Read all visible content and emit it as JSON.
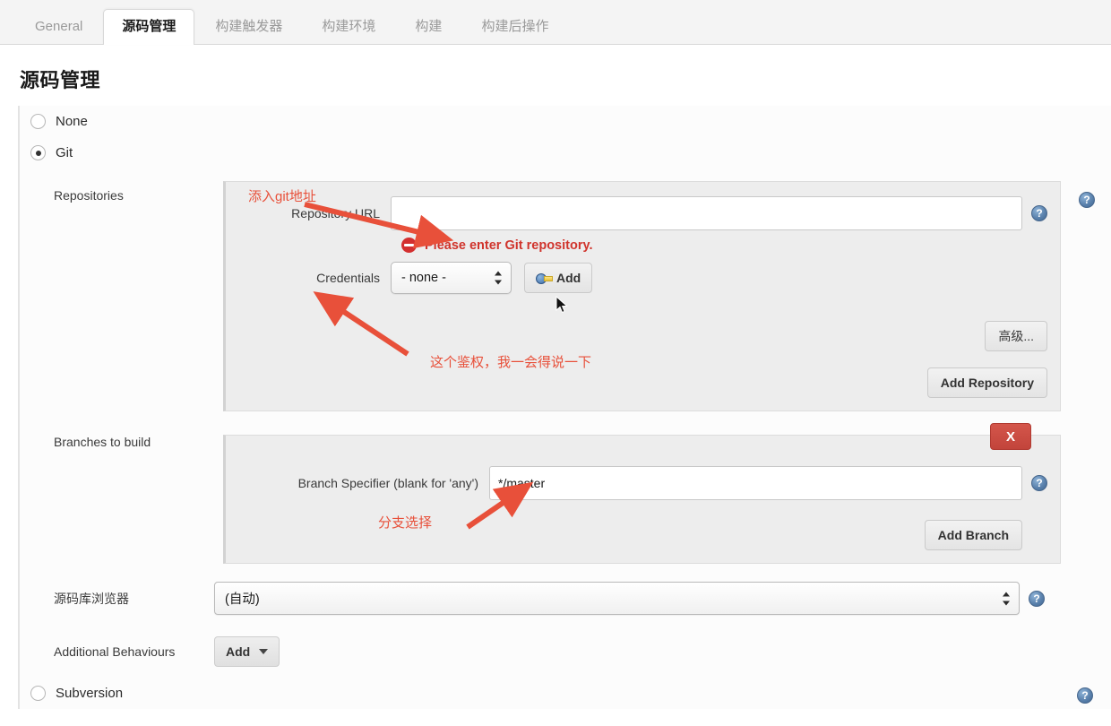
{
  "tabs": [
    {
      "label": "General",
      "active": false
    },
    {
      "label": "源码管理",
      "active": true
    },
    {
      "label": "构建触发器",
      "active": false
    },
    {
      "label": "构建环境",
      "active": false
    },
    {
      "label": "构建",
      "active": false
    },
    {
      "label": "构建后操作",
      "active": false
    }
  ],
  "page": {
    "title": "源码管理"
  },
  "scm": {
    "none_label": "None",
    "git_label": "Git",
    "subversion_label": "Subversion"
  },
  "repositories": {
    "section_label": "Repositories",
    "url_label": "Repository URL",
    "url_value": "",
    "url_placeholder": "",
    "error_text": "Please enter Git repository.",
    "credentials_label": "Credentials",
    "credentials_value": "- none -",
    "credentials_options": [
      "- none -"
    ],
    "add_credentials_label": "Add",
    "advanced_label": "高级...",
    "add_repository_label": "Add Repository"
  },
  "branches": {
    "section_label": "Branches to build",
    "specifier_label": "Branch Specifier (blank for 'any')",
    "specifier_value": "*/master",
    "delete_label": "X",
    "add_branch_label": "Add Branch"
  },
  "browser": {
    "label": "源码库浏览器",
    "value": "(自动)",
    "options": [
      "(自动)"
    ]
  },
  "behaviours": {
    "label": "Additional Behaviours",
    "add_label": "Add"
  },
  "icons": {
    "help": "?"
  },
  "annotations": [
    {
      "text": "添入git地址"
    },
    {
      "text": "这个鉴权，我一会得说一下"
    },
    {
      "text": "分支选择"
    }
  ],
  "colors": {
    "annotation": "#e8503a",
    "error": "#d0342c",
    "danger": "#c2443b",
    "help_icon": "#46668c",
    "panel_bg": "#ededed"
  }
}
